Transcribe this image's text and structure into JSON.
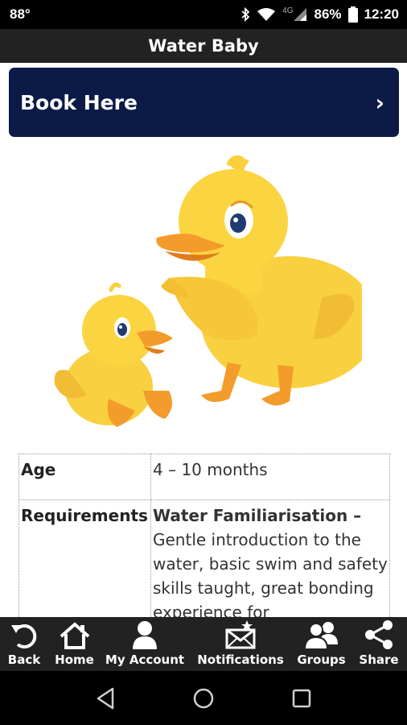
{
  "status_bar": {
    "temperature": "88°",
    "network": "4G",
    "battery": "86%",
    "time": "12:20"
  },
  "header": {
    "title": "Water Baby"
  },
  "book_button": {
    "label": "Book Here",
    "chevron": "›"
  },
  "illustration": {
    "icon": "ducks-illustration"
  },
  "info_table": {
    "rows": [
      {
        "label": "Age",
        "value": "4 – 10 months"
      },
      {
        "label": "Requirements",
        "value_title": "Water Familiarisation –",
        "value_text": "Gentle introduction to the water, basic swim and safety skills taught, great bonding experience for"
      }
    ]
  },
  "tab_bar": {
    "items": [
      {
        "label": "Back",
        "icon": "back-arrow-icon"
      },
      {
        "label": "Home",
        "icon": "home-icon"
      },
      {
        "label": "My Account",
        "icon": "user-icon"
      },
      {
        "label": "Notifications",
        "icon": "mail-star-icon"
      },
      {
        "label": "Groups",
        "icon": "group-icon"
      },
      {
        "label": "Share",
        "icon": "share-icon"
      }
    ]
  },
  "colors": {
    "title_bar": "#222222",
    "book_button": "#0b1a47",
    "duck_body": "#f9d03f",
    "duck_beak": "#f39c2b"
  }
}
